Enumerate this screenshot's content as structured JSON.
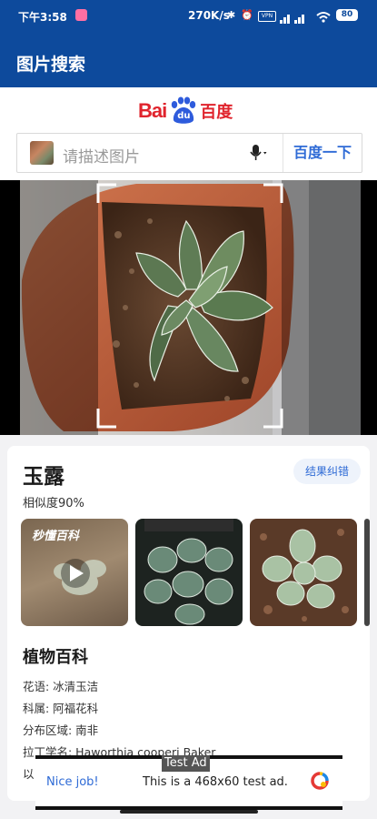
{
  "status": {
    "time": "下午3:58",
    "speed": "270K/s",
    "battery": "80"
  },
  "appbar": {
    "title": "图片搜索"
  },
  "logo": {
    "left": "Bai",
    "right": "百度",
    "paw_text": "du"
  },
  "search": {
    "placeholder": "请描述图片",
    "button": "百度一下"
  },
  "result": {
    "name": "玉露",
    "similarity": "相似度90%",
    "correct_button": "结果纠错",
    "thumb_video_watermark": "秒懂百科",
    "encyclopedia_title": "植物百科",
    "info": [
      "花语: 冰清玉洁",
      "科属: 阿福花科",
      "分布区域: 南非",
      "拉丁学名: Haworthia cooperi Baker",
      "以"
    ]
  },
  "ad": {
    "label": "Test Ad",
    "cta": "Nice job!",
    "text": "This is a 468x60 test ad."
  }
}
